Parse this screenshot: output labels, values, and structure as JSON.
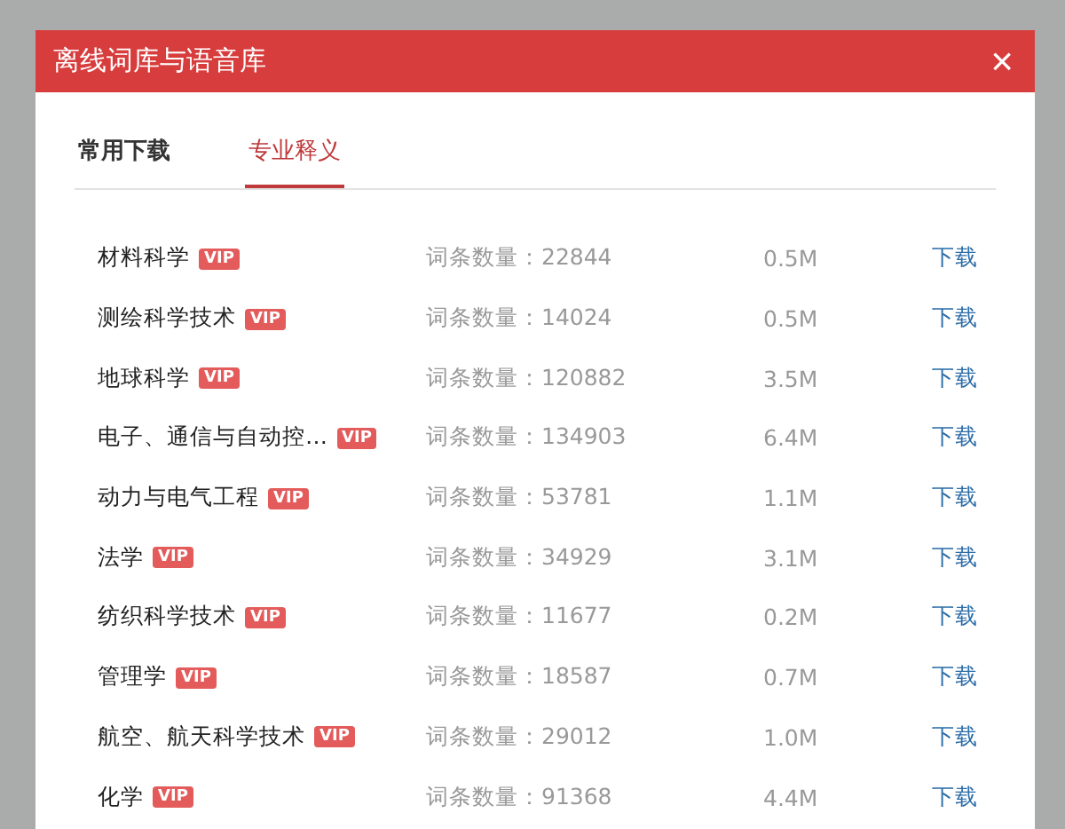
{
  "window": {
    "title": "离线词库与语音库",
    "close": "×"
  },
  "tabs": [
    {
      "label": "常用下载",
      "selected": false
    },
    {
      "label": "专业释义",
      "selected": true
    }
  ],
  "rows": [
    {
      "name": "材料科学",
      "badge": "VIP",
      "count": "词条数量：22844",
      "size": "0.5M",
      "action": "下载"
    },
    {
      "name": "测绘科学技术",
      "badge": "VIP",
      "count": "词条数量：14024",
      "size": "0.5M",
      "action": "下载"
    },
    {
      "name": "地球科学",
      "badge": "VIP",
      "count": "词条数量：120882",
      "size": "3.5M",
      "action": "下载"
    },
    {
      "name": "电子、通信与自动控…",
      "badge": "VIP",
      "count": "词条数量：134903",
      "size": "6.4M",
      "action": "下载"
    },
    {
      "name": "动力与电气工程",
      "badge": "VIP",
      "count": "词条数量：53781",
      "size": "1.1M",
      "action": "下载"
    },
    {
      "name": "法学",
      "badge": "VIP",
      "count": "词条数量：34929",
      "size": "3.1M",
      "action": "下载"
    },
    {
      "name": "纺织科学技术",
      "badge": "VIP",
      "count": "词条数量：11677",
      "size": "0.2M",
      "action": "下载"
    },
    {
      "name": "管理学",
      "badge": "VIP",
      "count": "词条数量：18587",
      "size": "0.7M",
      "action": "下载"
    },
    {
      "name": "航空、航天科学技术",
      "badge": "VIP",
      "count": "词条数量：29012",
      "size": "1.0M",
      "action": "下载"
    },
    {
      "name": "化学",
      "badge": "VIP",
      "count": "词条数量：91368",
      "size": "4.4M",
      "action": "下载"
    }
  ]
}
